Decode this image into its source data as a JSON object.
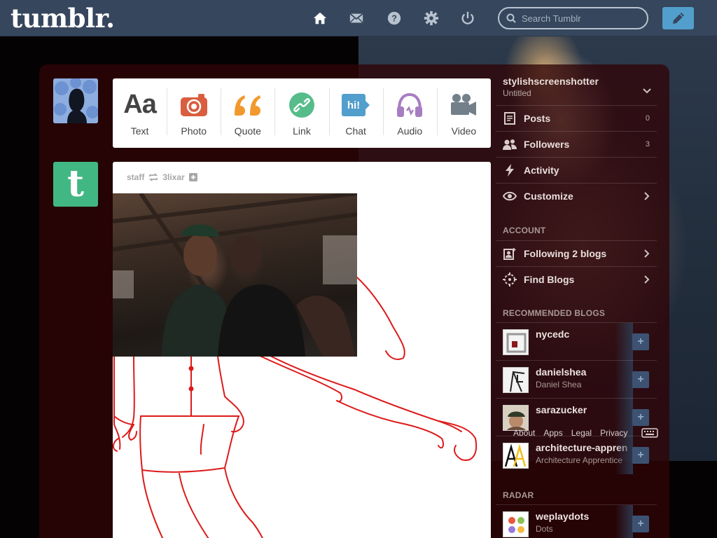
{
  "topbar": {
    "logo": "tumblr.",
    "search_placeholder": "Search Tumblr",
    "icons": [
      "home-icon",
      "mail-icon",
      "help-icon",
      "settings-icon",
      "power-icon"
    ],
    "compose_icon": "pencil-icon",
    "accent_color": "#529ecc",
    "bar_color": "#36465d"
  },
  "post_types": [
    {
      "label": "Text",
      "icon": "text-icon",
      "color": "#444444"
    },
    {
      "label": "Photo",
      "icon": "camera-icon",
      "color": "#d95e40"
    },
    {
      "label": "Quote",
      "icon": "quote-icon",
      "color": "#f2992e"
    },
    {
      "label": "Link",
      "icon": "link-icon",
      "color": "#56bc8a"
    },
    {
      "label": "Chat",
      "icon": "chat-icon",
      "color": "#529ecc"
    },
    {
      "label": "Audio",
      "icon": "headphones-icon",
      "color": "#a77dc2"
    },
    {
      "label": "Video",
      "icon": "video-camera-icon",
      "color": "#748089"
    }
  ],
  "post": {
    "author": "staff",
    "reblogged_from": "3lixar"
  },
  "sidebar": {
    "blog_name": "stylishscreenshotter",
    "blog_subtitle": "Untitled",
    "menu": [
      {
        "label": "Posts",
        "count": "0",
        "icon": "posts-icon"
      },
      {
        "label": "Followers",
        "count": "3",
        "icon": "followers-icon"
      },
      {
        "label": "Activity",
        "icon": "activity-icon"
      },
      {
        "label": "Customize",
        "icon": "eye-icon"
      }
    ],
    "account_title": "ACCOUNT",
    "account_items": [
      {
        "label": "Following 2 blogs",
        "icon": "following-icon"
      },
      {
        "label": "Find Blogs",
        "icon": "compass-icon"
      }
    ],
    "recommended_title": "RECOMMENDED BLOGS",
    "recommended": [
      {
        "name": "nycedc",
        "subtitle": ""
      },
      {
        "name": "danielshea",
        "subtitle": "Daniel Shea"
      },
      {
        "name": "sarazucker",
        "subtitle": ""
      },
      {
        "name": "architecture-appren",
        "subtitle": "Architecture Apprentice"
      }
    ],
    "radar_title": "RADAR",
    "radar": [
      {
        "name": "weplaydots",
        "subtitle": "Dots"
      }
    ]
  },
  "footer": {
    "links": [
      "About",
      "Apps",
      "Legal",
      "Privacy"
    ]
  }
}
